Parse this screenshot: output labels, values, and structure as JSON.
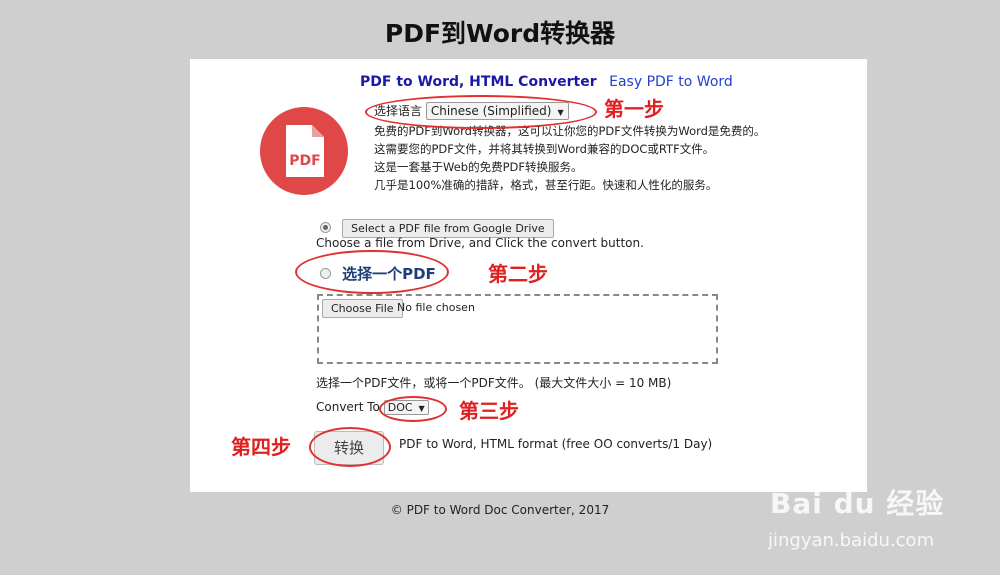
{
  "page_title": "PDF到Word转换器",
  "header": {
    "brand": "PDF to Word, HTML Converter",
    "subtitle": "Easy PDF to Word"
  },
  "logo_text": "PDF",
  "language": {
    "label": "选择语言",
    "selected": "Chinese (Simplified)"
  },
  "description": [
    "免费的PDF到Word转换器，这可以让你您的PDF文件转换为Word是免费的。",
    "这需要您的PDF文件，并将其转换到Word兼容的DOC或RTF文件。",
    "这是一套基于Web的免费PDF转换服务。",
    "几乎是100%准确的措辞，格式，甚至行距。快速和人性化的服务。"
  ],
  "google_drive": {
    "button_label": "Select a PDF file from Google Drive",
    "hint": "Choose a file from Drive, and Click the convert button."
  },
  "local_pick": {
    "label": "选择一个PDF",
    "choose_button": "Choose File",
    "no_file": "No file chosen"
  },
  "limit_text": "选择一个PDF文件，或将一个PDF文件。 (最大文件大小 = 10 MB)",
  "convert": {
    "label": "Convert To",
    "selected": "DOC"
  },
  "submit": {
    "label": "转换",
    "note": "PDF to Word, HTML format (free OO converts/1 Day)"
  },
  "footer": "© PDF to Word Doc Converter, 2017",
  "annotations": {
    "step1": "第一步",
    "step2": "第二步",
    "step3": "第三步",
    "step4": "第四步",
    "color": "#e02020"
  },
  "watermark": {
    "brand": "Bai du 经验",
    "url": "jingyan.baidu.com"
  },
  "colors": {
    "background": "#cfcfcf",
    "brand": "#1a1aa6",
    "logo": "#e04848"
  }
}
